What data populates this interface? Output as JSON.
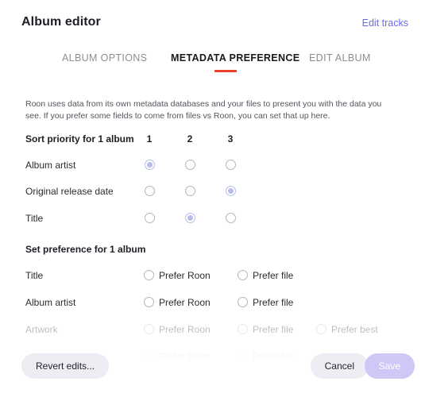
{
  "header": {
    "title": "Album editor",
    "edit_tracks_label": "Edit tracks"
  },
  "tabs": [
    {
      "label": "ALBUM OPTIONS",
      "active": false
    },
    {
      "label": "METADATA PREFERENCE",
      "active": true
    },
    {
      "label": "EDIT ALBUM",
      "active": false
    }
  ],
  "description": "Roon uses data from its own metadata databases and your files to present you with the data you see. If you prefer some fields to come from files vs Roon, you can set that up here.",
  "sort_priority": {
    "title": "Sort priority for 1 album",
    "columns": [
      "1",
      "2",
      "3"
    ],
    "rows": [
      {
        "label": "Album artist",
        "selected": 0
      },
      {
        "label": "Original release date",
        "selected": 2
      },
      {
        "label": "Title",
        "selected": 1
      }
    ]
  },
  "set_preference": {
    "title": "Set preference for 1 album",
    "rows": [
      {
        "label": "Title",
        "options": [
          "Prefer Roon",
          "Prefer file"
        ],
        "selected": -1,
        "state": "normal"
      },
      {
        "label": "Album artist",
        "options": [
          "Prefer Roon",
          "Prefer file"
        ],
        "selected": -1,
        "state": "normal"
      },
      {
        "label": "Artwork",
        "options": [
          "Prefer Roon",
          "Prefer file",
          "Prefer best"
        ],
        "selected": -1,
        "state": "faded"
      },
      {
        "label": "",
        "options": [
          "Prefer Roon",
          "Prefer file"
        ],
        "selected": -1,
        "state": "faded-more"
      }
    ]
  },
  "footer": {
    "revert_label": "Revert edits...",
    "cancel_label": "Cancel",
    "save_label": "Save"
  },
  "colors": {
    "accent_link": "#6a6ce6",
    "tab_underline": "#e8402a",
    "radio_selected": "#b9bbea",
    "save_button": "#cdc8f5",
    "neutral_button": "#eceef4"
  }
}
